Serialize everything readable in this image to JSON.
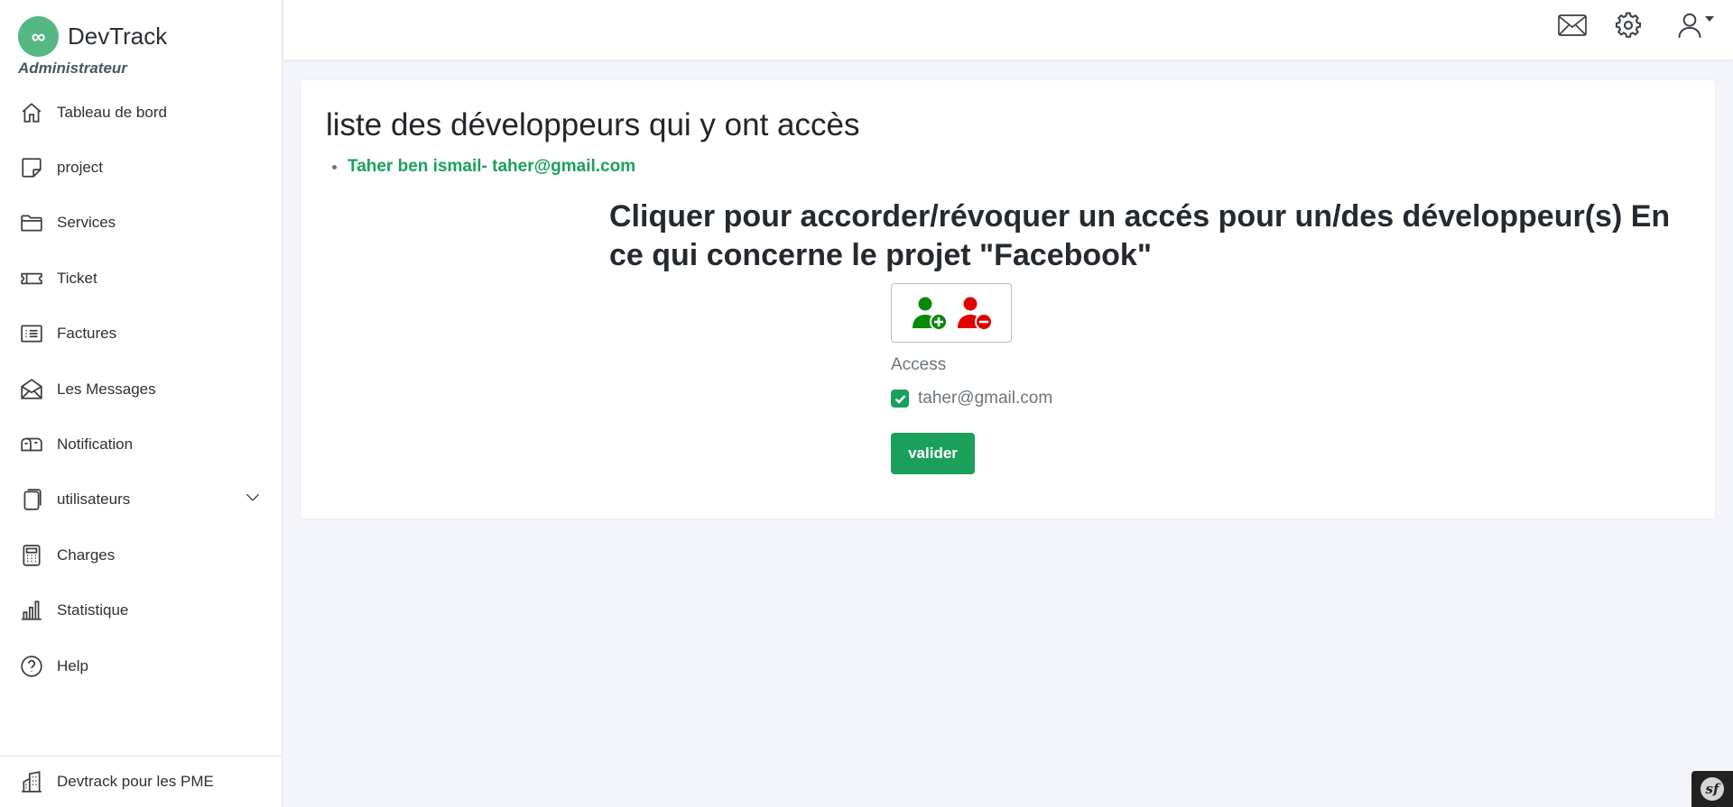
{
  "brand": {
    "name": "DevTrack",
    "logo_glyph": "∞",
    "logo_color": "#55b882"
  },
  "role": "Administrateur",
  "sidebar": {
    "items": [
      {
        "label": "Tableau de bord",
        "icon": "home-icon"
      },
      {
        "label": "project",
        "icon": "sticky-note-icon"
      },
      {
        "label": "Services",
        "icon": "folder-icon"
      },
      {
        "label": "Ticket",
        "icon": "ticket-icon"
      },
      {
        "label": "Factures",
        "icon": "list-icon"
      },
      {
        "label": "Les Messages",
        "icon": "envelope-open-icon"
      },
      {
        "label": "Notification",
        "icon": "mailbox-icon"
      },
      {
        "label": "utilisateurs",
        "icon": "files-icon",
        "expandable": true
      },
      {
        "label": "Charges",
        "icon": "calculator-icon"
      },
      {
        "label": "Statistique",
        "icon": "bar-chart-icon"
      },
      {
        "label": "Help",
        "icon": "question-circle-icon"
      }
    ],
    "footer": {
      "label": "Devtrack pour les PME",
      "icon": "buildings-icon"
    }
  },
  "topbar": {
    "icons": [
      "envelope-icon",
      "gear-icon",
      "user-icon"
    ]
  },
  "main": {
    "list_title": "liste des développeurs qui y ont accès",
    "developers": [
      "Taher ben ismail- taher@gmail.com"
    ],
    "heading": "Cliquer pour accorder/révoquer un accés pour un/des développeur(s) En ce qui concerne le projet \"Facebook\"",
    "access_label": "Access",
    "access_options": [
      {
        "label": "taher@gmail.com",
        "checked": true
      }
    ],
    "submit_label": "valider"
  },
  "colors": {
    "accent": "#1ba05c",
    "grant": "#0a8a0a",
    "revoke": "#e00000",
    "background": "#f4f5fb"
  },
  "debug_badge": {
    "glyph": "sf"
  }
}
